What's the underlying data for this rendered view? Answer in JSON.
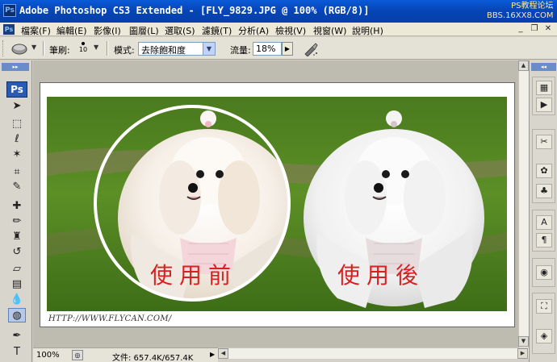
{
  "window": {
    "title": "Adobe Photoshop CS3 Extended - [FLY_9829.JPG @ 100% (RGB/8)]",
    "watermark_line1": "PS教程论坛",
    "watermark_line2": "BBS.16XX8.COM",
    "app_icon": "Ps"
  },
  "menu": {
    "items": [
      "檔案(F)",
      "編輯(E)",
      "影像(I)",
      "圖層(L)",
      "選取(S)",
      "濾鏡(T)",
      "分析(A)",
      "檢視(V)",
      "視窗(W)",
      "說明(H)"
    ],
    "minimize": "_",
    "restore": "❐",
    "close": "✕"
  },
  "options": {
    "brush_label": "筆刷:",
    "brush_size": "10",
    "mode_label": "模式:",
    "mode_value": "去除飽和度",
    "flow_label": "流量:",
    "flow_value": "18%"
  },
  "toolbox": {
    "logo": "Ps",
    "tools": [
      {
        "name": "move-tool",
        "glyph": "➤"
      },
      {
        "name": "marquee-tool",
        "glyph": "⬚"
      },
      {
        "name": "lasso-tool",
        "glyph": "ℓ"
      },
      {
        "name": "magic-wand-tool",
        "glyph": "✶"
      },
      {
        "name": "crop-tool",
        "glyph": "⌗"
      },
      {
        "name": "eyedropper-tool",
        "glyph": "✎"
      },
      {
        "name": "healing-brush-tool",
        "glyph": "✚"
      },
      {
        "name": "brush-tool",
        "glyph": "✏"
      },
      {
        "name": "clone-stamp-tool",
        "glyph": "♜"
      },
      {
        "name": "history-brush-tool",
        "glyph": "↺"
      },
      {
        "name": "eraser-tool",
        "glyph": "▱"
      },
      {
        "name": "gradient-tool",
        "glyph": "▤"
      },
      {
        "name": "blur-tool",
        "glyph": "💧"
      },
      {
        "name": "sponge-tool",
        "glyph": "◍"
      },
      {
        "name": "pen-tool",
        "glyph": "✒"
      },
      {
        "name": "type-tool",
        "glyph": "T"
      }
    ]
  },
  "document": {
    "caption_before": "使用前",
    "caption_after": "使用後",
    "credit": "HTTP://WWW.FLYCAN.COM/"
  },
  "status": {
    "zoom": "100%",
    "doc_size": "文件: 657.4K/657.4K"
  },
  "dock": {
    "buttons": [
      {
        "name": "history-icon",
        "glyph": "▦"
      },
      {
        "name": "actions-icon",
        "glyph": "▶"
      },
      {
        "name": "tool-presets-icon",
        "glyph": "✂"
      },
      {
        "name": "brushes-icon",
        "glyph": "✿"
      },
      {
        "name": "clone-source-icon",
        "glyph": "♣"
      },
      {
        "name": "character-icon",
        "glyph": "A"
      },
      {
        "name": "paragraph-icon",
        "glyph": "¶"
      },
      {
        "name": "color-icon",
        "glyph": "◉"
      },
      {
        "name": "navigator-icon",
        "glyph": "⛶"
      },
      {
        "name": "layers-icon",
        "glyph": "◈"
      }
    ]
  }
}
